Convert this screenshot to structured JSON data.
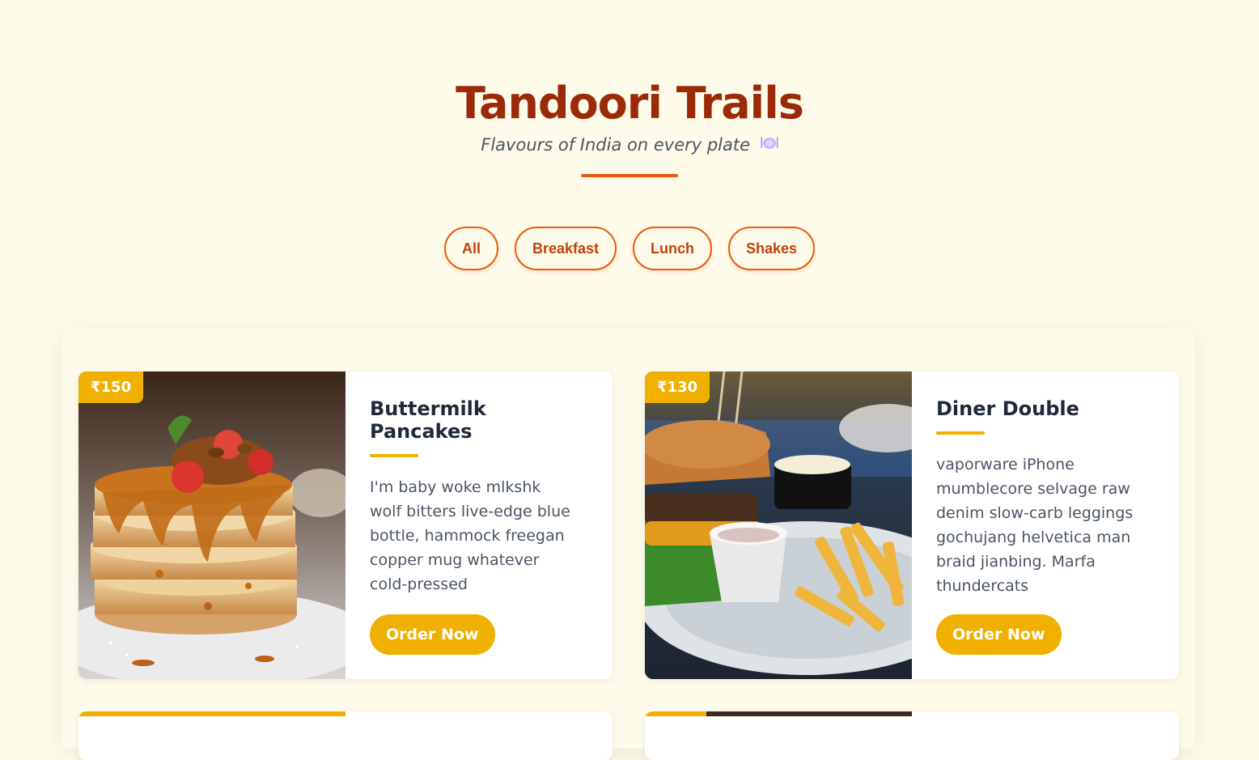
{
  "header": {
    "title": "Tandoori Trails",
    "subtitle": "Flavours of India on every plate",
    "subtitle_icon": "plate-icon",
    "accent_color": "#ea580c"
  },
  "filters": [
    {
      "label": "All"
    },
    {
      "label": "Breakfast"
    },
    {
      "label": "Lunch"
    },
    {
      "label": "Shakes"
    }
  ],
  "menu": [
    {
      "price": "₹150",
      "title": "Buttermilk Pancakes",
      "description": "I'm baby woke mlkshk wolf bitters live-edge blue bottle, hammock freegan copper mug whatever cold-pressed",
      "button": "Order Now",
      "image": "pancakes-photo"
    },
    {
      "price": "₹130",
      "title": "Diner Double",
      "description": "vaporware iPhone mumblecore selvage raw denim slow-carb leggings gochujang helvetica man braid jianbing. Marfa thundercats",
      "button": "Order Now",
      "image": "burger-photo"
    }
  ],
  "colors": {
    "background": "#fffbea",
    "title": "#9a2a08",
    "badge": "#f0b000"
  }
}
